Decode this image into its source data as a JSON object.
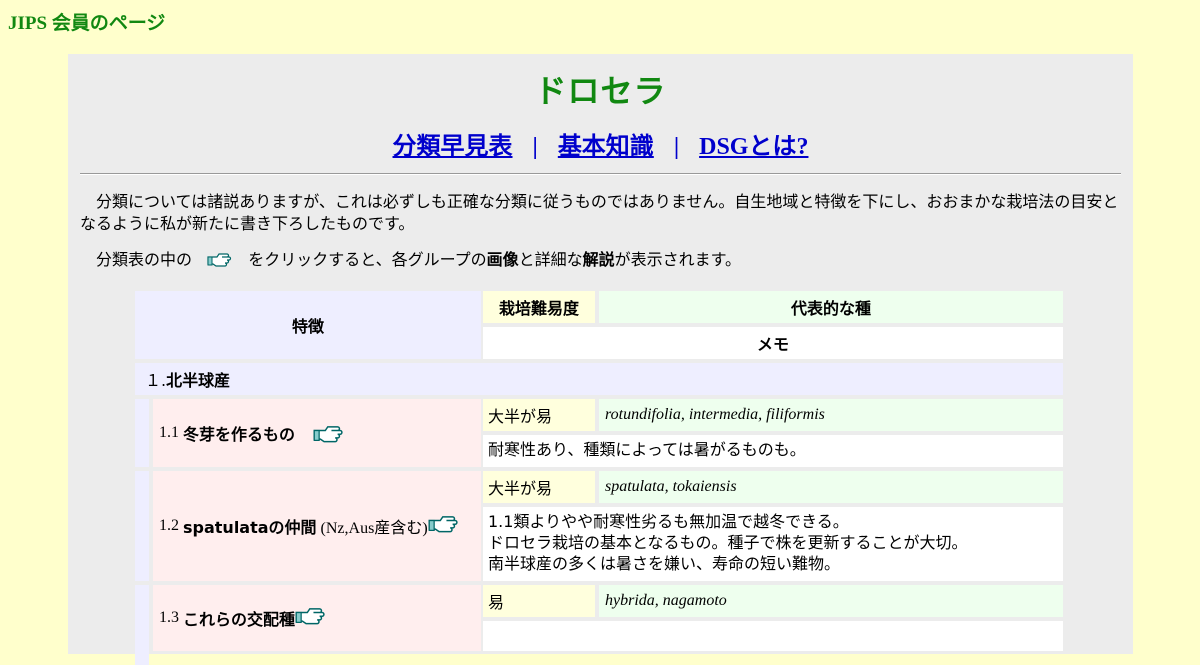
{
  "site": {
    "title": "JIPS 会員のページ"
  },
  "page": {
    "title": "ドロセラ"
  },
  "nav": {
    "links": [
      "分類早見表",
      "基本知識",
      "DSGとは?"
    ],
    "separator": "|"
  },
  "intro": {
    "paragraph1": "分類については諸説ありますが、これは必ずしも正確な分類に従うものではありません。自生地域と特徴を下にし、おおまかな栽培法の目安となるように私が新たに書き下ろしたものです。",
    "p2_before": "分類表の中の",
    "p2_mid1": "をクリックすると、各グループの",
    "p2_bold1": "画像",
    "p2_mid2": "と詳細な",
    "p2_bold2": "解説",
    "p2_after": "が表示されます。"
  },
  "table": {
    "headers": {
      "feature": "特徴",
      "difficulty": "栽培難易度",
      "species": "代表的な種",
      "memo": "メモ"
    },
    "group1": {
      "prefix": "１.",
      "label": "北半球産"
    },
    "rows": [
      {
        "num": "1.1",
        "name": "冬芽を作るもの",
        "note": "",
        "difficulty": "大半が易",
        "species": "rotundifolia, intermedia, filiformis",
        "memo": [
          "耐寒性あり、種類によっては暑がるものも。"
        ]
      },
      {
        "num": "1.2",
        "name": "spatulataの仲間",
        "note": "(Nz,Aus産含む)",
        "difficulty": "大半が易",
        "species": "spatulata, tokaiensis",
        "memo": [
          "1.1類よりやや耐寒性劣るも無加温で越冬できる。",
          "ドロセラ栽培の基本となるもの。種子で株を更新することが大切。",
          "南半球産の多くは暑さを嫌い、寿命の短い難物。"
        ]
      },
      {
        "num": "1.3",
        "name": "これらの交配種",
        "note": "",
        "difficulty": "易",
        "species": "hybrida, nagamoto",
        "memo": [
          "",
          ""
        ]
      }
    ]
  },
  "colors": {
    "background": "#ffffcc",
    "panel": "#ececec",
    "title_green": "#118811",
    "link_blue": "#0000cc"
  },
  "icons": {
    "pointer": "pointing-hand-icon"
  }
}
